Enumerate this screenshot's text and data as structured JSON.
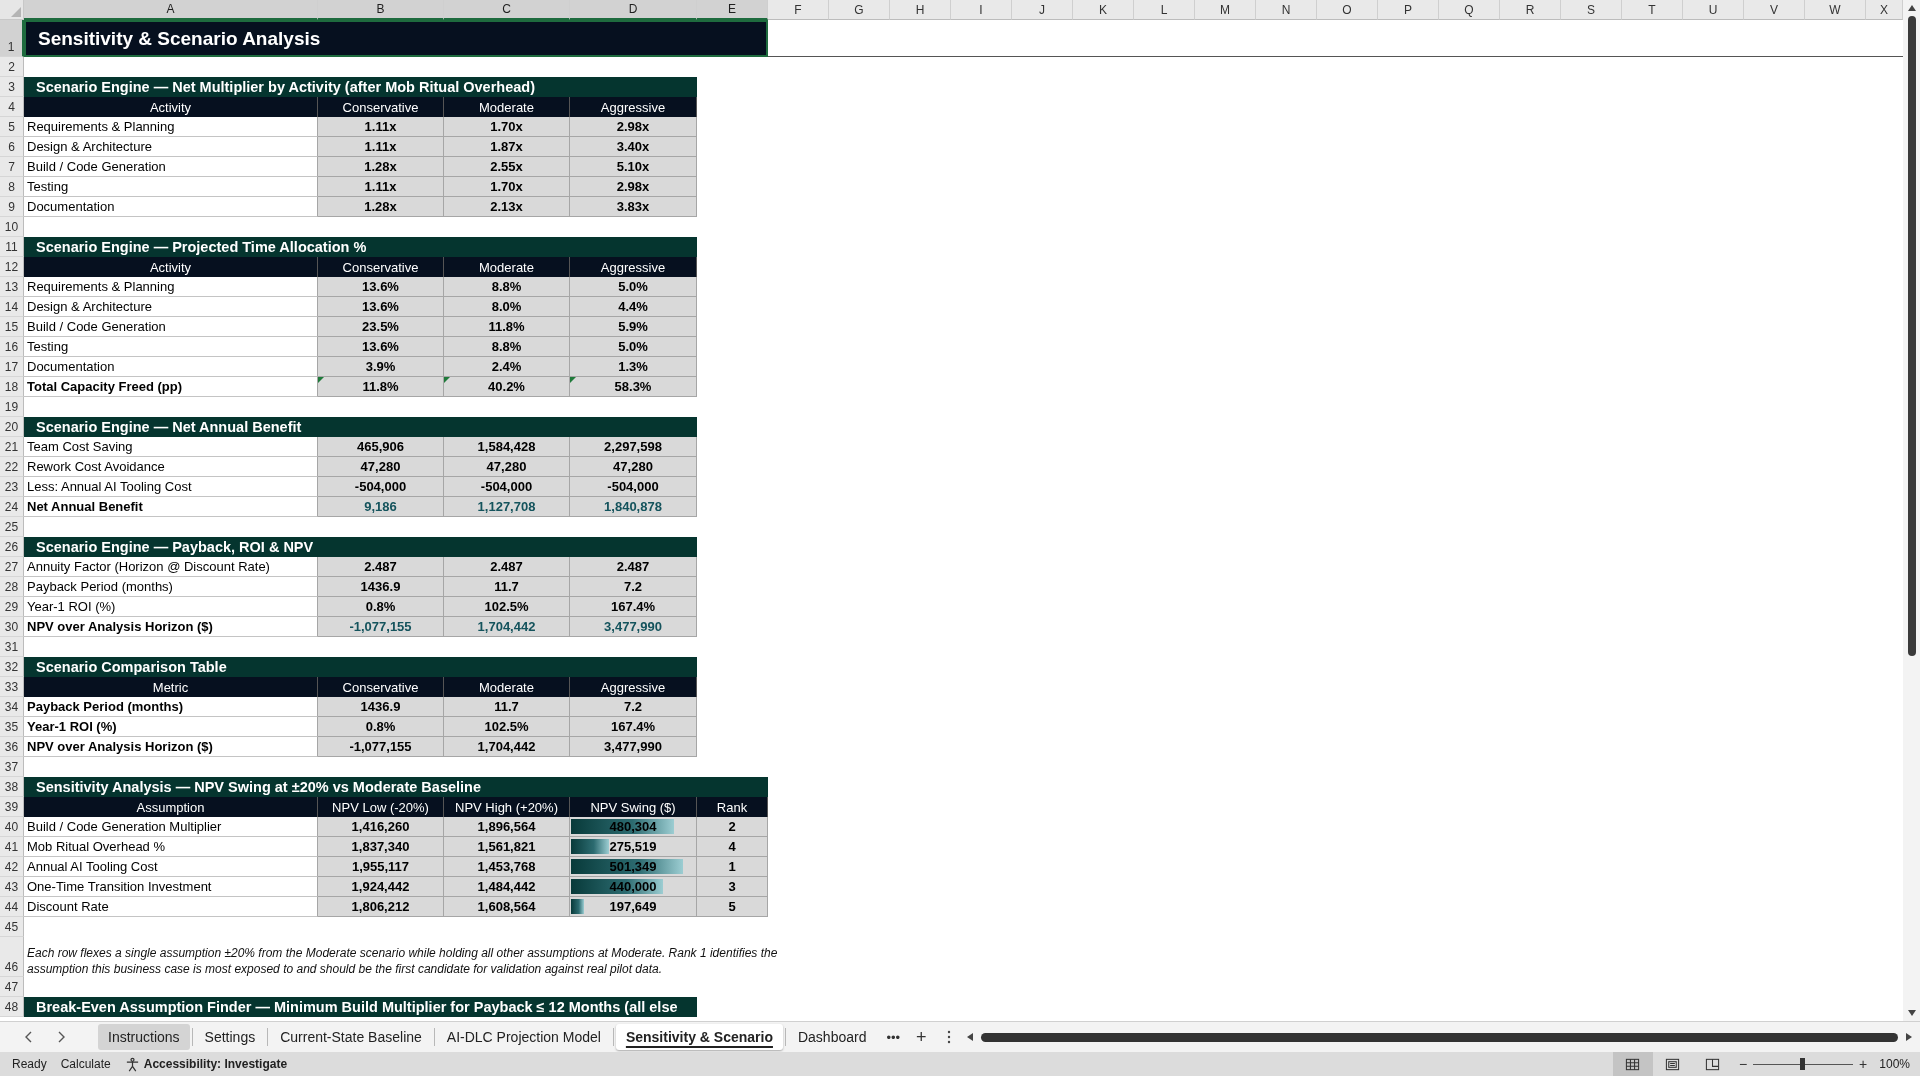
{
  "column_headers": [
    {
      "label": "A",
      "selected": true
    },
    {
      "label": "B",
      "selected": true
    },
    {
      "label": "C",
      "selected": true
    },
    {
      "label": "D",
      "selected": true
    },
    {
      "label": "E",
      "selected": true
    },
    {
      "label": "F",
      "selected": false
    },
    {
      "label": "G",
      "selected": false
    },
    {
      "label": "H",
      "selected": false
    },
    {
      "label": "I",
      "selected": false
    },
    {
      "label": "J",
      "selected": false
    },
    {
      "label": "K",
      "selected": false
    },
    {
      "label": "L",
      "selected": false
    },
    {
      "label": "M",
      "selected": false
    },
    {
      "label": "N",
      "selected": false
    },
    {
      "label": "O",
      "selected": false
    },
    {
      "label": "P",
      "selected": false
    },
    {
      "label": "Q",
      "selected": false
    },
    {
      "label": "R",
      "selected": false
    },
    {
      "label": "S",
      "selected": false
    },
    {
      "label": "T",
      "selected": false
    },
    {
      "label": "U",
      "selected": false
    },
    {
      "label": "V",
      "selected": false
    },
    {
      "label": "W",
      "selected": false
    },
    {
      "label": "X",
      "selected": false
    }
  ],
  "row_numbers": [
    {
      "label": "1",
      "selected": true
    },
    {
      "label": "2",
      "selected": false
    },
    {
      "label": "3",
      "selected": false
    },
    {
      "label": "4",
      "selected": false
    },
    {
      "label": "5",
      "selected": false
    },
    {
      "label": "6",
      "selected": false
    },
    {
      "label": "7",
      "selected": false
    },
    {
      "label": "8",
      "selected": false
    },
    {
      "label": "9",
      "selected": false
    },
    {
      "label": "10",
      "selected": false
    },
    {
      "label": "11",
      "selected": false
    },
    {
      "label": "12",
      "selected": false
    },
    {
      "label": "13",
      "selected": false
    },
    {
      "label": "14",
      "selected": false
    },
    {
      "label": "15",
      "selected": false
    },
    {
      "label": "16",
      "selected": false
    },
    {
      "label": "17",
      "selected": false
    },
    {
      "label": "18",
      "selected": false
    },
    {
      "label": "19",
      "selected": false
    },
    {
      "label": "20",
      "selected": false
    },
    {
      "label": "21",
      "selected": false
    },
    {
      "label": "22",
      "selected": false
    },
    {
      "label": "23",
      "selected": false
    },
    {
      "label": "24",
      "selected": false
    },
    {
      "label": "25",
      "selected": false
    },
    {
      "label": "26",
      "selected": false
    },
    {
      "label": "27",
      "selected": false
    },
    {
      "label": "28",
      "selected": false
    },
    {
      "label": "29",
      "selected": false
    },
    {
      "label": "30",
      "selected": false
    },
    {
      "label": "31",
      "selected": false
    },
    {
      "label": "32",
      "selected": false
    },
    {
      "label": "33",
      "selected": false
    },
    {
      "label": "34",
      "selected": false
    },
    {
      "label": "35",
      "selected": false
    },
    {
      "label": "36",
      "selected": false
    },
    {
      "label": "37",
      "selected": false
    },
    {
      "label": "38",
      "selected": false
    },
    {
      "label": "39",
      "selected": false
    },
    {
      "label": "40",
      "selected": false
    },
    {
      "label": "41",
      "selected": false
    },
    {
      "label": "42",
      "selected": false
    },
    {
      "label": "43",
      "selected": false
    },
    {
      "label": "44",
      "selected": false
    },
    {
      "label": "45",
      "selected": false
    },
    {
      "label": "46",
      "selected": false
    },
    {
      "label": "47",
      "selected": false
    },
    {
      "label": "48",
      "selected": false
    }
  ],
  "title": "Sensitivity & Scenario Analysis",
  "sections": [
    {
      "kind": "table",
      "title": "Scenario Engine — Net Multiplier by Activity (after Mob Ritual Overhead)",
      "header": [
        "Activity",
        "Conservative",
        "Moderate",
        "Aggressive"
      ],
      "rows": [
        {
          "kind": "plain",
          "flagged": false,
          "label": "Requirements & Planning",
          "values": [
            "1.11x",
            "1.70x",
            "2.98x"
          ]
        },
        {
          "kind": "plain",
          "flagged": false,
          "label": "Design & Architecture",
          "values": [
            "1.11x",
            "1.87x",
            "3.40x"
          ]
        },
        {
          "kind": "plain",
          "flagged": false,
          "label": "Build / Code Generation",
          "values": [
            "1.28x",
            "2.55x",
            "5.10x"
          ]
        },
        {
          "kind": "plain",
          "flagged": false,
          "label": "Testing",
          "values": [
            "1.11x",
            "1.70x",
            "2.98x"
          ]
        },
        {
          "kind": "plain",
          "flagged": false,
          "label": "Documentation",
          "values": [
            "1.28x",
            "2.13x",
            "3.83x"
          ]
        }
      ]
    },
    {
      "kind": "table",
      "title": "Scenario Engine — Projected Time Allocation %",
      "header": [
        "Activity",
        "Conservative",
        "Moderate",
        "Aggressive"
      ],
      "rows": [
        {
          "kind": "plain",
          "flagged": false,
          "label": "Requirements & Planning",
          "values": [
            "13.6%",
            "8.8%",
            "5.0%"
          ]
        },
        {
          "kind": "plain",
          "flagged": false,
          "label": "Design & Architecture",
          "values": [
            "13.6%",
            "8.0%",
            "4.4%"
          ]
        },
        {
          "kind": "plain",
          "flagged": false,
          "label": "Build / Code Generation",
          "values": [
            "23.5%",
            "11.8%",
            "5.9%"
          ]
        },
        {
          "kind": "plain",
          "flagged": false,
          "label": "Testing",
          "values": [
            "13.6%",
            "8.8%",
            "5.0%"
          ]
        },
        {
          "kind": "plain",
          "flagged": false,
          "label": "Documentation",
          "values": [
            "3.9%",
            "2.4%",
            "1.3%"
          ]
        },
        {
          "kind": "total",
          "flagged": true,
          "label": "Total Capacity Freed (pp)",
          "values": [
            "11.8%",
            "40.2%",
            "58.3%"
          ]
        }
      ]
    },
    {
      "kind": "table",
      "title": "Scenario Engine — Net Annual Benefit",
      "rows": [
        {
          "kind": "plain",
          "flagged": false,
          "label": "Team Cost Saving",
          "values": [
            "465,906",
            "1,584,428",
            "2,297,598"
          ]
        },
        {
          "kind": "plain",
          "flagged": false,
          "label": "Rework Cost Avoidance",
          "values": [
            "47,280",
            "47,280",
            "47,280"
          ]
        },
        {
          "kind": "plain",
          "flagged": false,
          "label": "Less: Annual AI Tooling Cost",
          "values": [
            "-504,000",
            "-504,000",
            "-504,000"
          ]
        },
        {
          "kind": "result",
          "flagged": false,
          "label": "Net Annual Benefit",
          "values": [
            "9,186",
            "1,127,708",
            "1,840,878"
          ]
        }
      ]
    },
    {
      "kind": "table",
      "title": "Scenario Engine — Payback, ROI & NPV",
      "rows": [
        {
          "kind": "plain",
          "flagged": false,
          "label": "Annuity Factor (Horizon @ Discount Rate)",
          "values": [
            "2.487",
            "2.487",
            "2.487"
          ]
        },
        {
          "kind": "plain",
          "flagged": false,
          "label": "Payback Period (months)",
          "values": [
            "1436.9",
            "11.7",
            "7.2"
          ]
        },
        {
          "kind": "plain",
          "flagged": false,
          "label": "Year-1 ROI (%)",
          "values": [
            "0.8%",
            "102.5%",
            "167.4%"
          ]
        },
        {
          "kind": "result",
          "flagged": false,
          "label": "NPV over Analysis Horizon ($)",
          "values": [
            "-1,077,155",
            "1,704,442",
            "3,477,990"
          ]
        }
      ]
    },
    {
      "kind": "table",
      "title": "Scenario Comparison Table",
      "header": [
        "Metric",
        "Conservative",
        "Moderate",
        "Aggressive"
      ],
      "rows": [
        {
          "kind": "total",
          "flagged": false,
          "label": "Payback Period (months)",
          "values": [
            "1436.9",
            "11.7",
            "7.2"
          ]
        },
        {
          "kind": "total",
          "flagged": false,
          "label": "Year-1 ROI (%)",
          "values": [
            "0.8%",
            "102.5%",
            "167.4%"
          ]
        },
        {
          "kind": "total",
          "flagged": false,
          "label": "NPV over Analysis Horizon ($)",
          "values": [
            "-1,077,155",
            "1,704,442",
            "3,477,990"
          ]
        }
      ]
    },
    {
      "kind": "sensitivity",
      "title": "Sensitivity Analysis — NPV Swing at ±20% vs Moderate Baseline",
      "header": [
        "Assumption",
        "NPV Low (-20%)",
        "NPV High (+20%)",
        "NPV Swing ($)",
        "Rank"
      ],
      "rows": [
        {
          "label": "Build / Code Generation Multiplier",
          "values": [
            "1,416,260",
            "1,896,564"
          ],
          "swing": "480,304",
          "level": 0.82,
          "rank": "2"
        },
        {
          "label": "Mob Ritual Overhead %",
          "values": [
            "1,837,340",
            "1,561,821"
          ],
          "swing": "275,519",
          "level": 0.3,
          "rank": "4"
        },
        {
          "label": "Annual AI Tooling Cost",
          "values": [
            "1,955,117",
            "1,453,768"
          ],
          "swing": "501,349",
          "level": 0.89,
          "rank": "1"
        },
        {
          "label": "One-Time Transition Investment",
          "values": [
            "1,924,442",
            "1,484,442"
          ],
          "swing": "440,000",
          "level": 0.73,
          "rank": "3"
        },
        {
          "label": "Discount Rate",
          "values": [
            "1,806,212",
            "1,608,564"
          ],
          "swing": "197,649",
          "level": 0.1,
          "rank": "5"
        }
      ]
    },
    {
      "kind": "note",
      "text": "Each row flexes a single assumption ±20% from the Moderate scenario while holding all other assumptions at Moderate. Rank 1 identifies the assumption this business case is most exposed to and should be the first candidate for validation against real pilot data."
    },
    {
      "kind": "banner",
      "title": "Break-Even Assumption Finder — Minimum Build Multiplier for Payback ≤ 12 Months (all else"
    }
  ],
  "sheet_tabs": [
    {
      "label": "Instructions",
      "selected": false,
      "hover": true
    },
    {
      "label": "Settings",
      "selected": false,
      "hover": false
    },
    {
      "label": "Current-State Baseline",
      "selected": false,
      "hover": false
    },
    {
      "label": "AI-DLC Projection Model",
      "selected": false,
      "hover": false
    },
    {
      "label": "Sensitivity & Scenario",
      "selected": true,
      "hover": false
    },
    {
      "label": "Dashboard",
      "selected": false,
      "hover": false
    }
  ],
  "tab_more": "•••",
  "tab_add": "+",
  "status_bar": {
    "mode": "Ready",
    "calculate": "Calculate",
    "accessibility": "Accessibility: Investigate",
    "views": [
      {
        "kind": "normal",
        "selected": true
      },
      {
        "kind": "page-layout",
        "selected": false
      },
      {
        "kind": "page-break",
        "selected": false
      }
    ],
    "zoom_minus": "−",
    "zoom_plus": "+",
    "zoom": {
      "level": 0.5
    },
    "zoom_reading": "100%"
  }
}
